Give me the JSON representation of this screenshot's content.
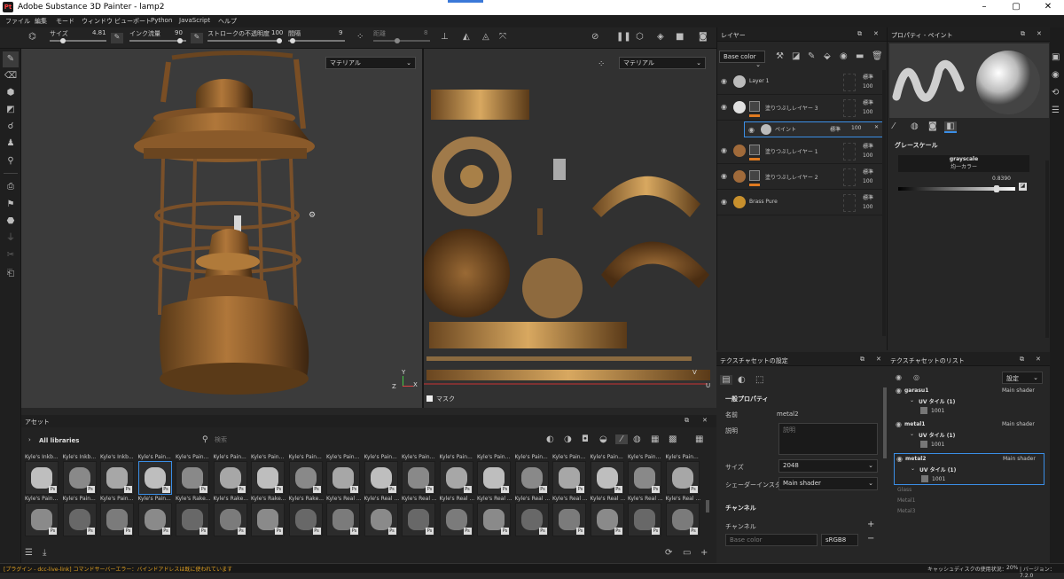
{
  "window": {
    "title": "Adobe Substance 3D Painter - lamp2",
    "app_icon": "Pt"
  },
  "menu": [
    "ファイル",
    "編集",
    "モード",
    "ウィンドウ",
    "ビューポート",
    "Python",
    "JavaScript",
    "ヘルプ"
  ],
  "toolbar": {
    "size_label": "サイズ",
    "size_value": "4.81",
    "flow_label": "インク流量",
    "flow_value": "90",
    "stroke_label": "ストロークの不透明度",
    "stroke_value": "100",
    "spacing_label": "間隔",
    "spacing_value": "9",
    "distance_label": "距離",
    "distance_value": "8"
  },
  "viewport": {
    "mode_3d": "マテリアル",
    "mode_2d": "マテリアル",
    "mask_label": "マスク",
    "axis_y": "Y",
    "axis_z": "Z",
    "axis_x": "X",
    "axis_u": "U",
    "axis_v": "V"
  },
  "assets": {
    "title": "アセット",
    "libraries": "All libraries",
    "search_placeholder": "検索",
    "row1": [
      "Kyle's Inkb...",
      "Kyle's Inkb...",
      "Kyle's Inkb...",
      "Kyle's Pain...",
      "Kyle's Pain...",
      "Kyle's Pain...",
      "Kyle's Pain...",
      "Kyle's Pain...",
      "Kyle's Pain...",
      "Kyle's Pain...",
      "Kyle's Pain...",
      "Kyle's Pain...",
      "Kyle's Pain...",
      "Kyle's Pain...",
      "Kyle's Pain...",
      "Kyle's Pain...",
      "Kyle's Pain...",
      "Kyle's Pain..."
    ],
    "row2": [
      "Kyle's Pain...",
      "Kyle's Pain...",
      "Kyle's Pain...",
      "Kyle's Pain...",
      "Kyle's Rake...",
      "Kyle's Rake...",
      "Kyle's Rake...",
      "Kyle's Rake...",
      "Kyle's Real ...",
      "Kyle's Real ...",
      "Kyle's Real ...",
      "Kyle's Real ...",
      "Kyle's Real ...",
      "Kyle's Real ...",
      "Kyle's Real ...",
      "Kyle's Real ...",
      "Kyle's Real ...",
      "Kyle's Real ..."
    ]
  },
  "status": {
    "error": "[プラグイン - dcc-live-link] コマンドサーバーエラー：バインドアドレスは既に使われています",
    "cache": "キャッシュディスクの使用状況：",
    "cache_value": "20%",
    "version": "| バージョン：7.2.0"
  },
  "layers": {
    "title": "レイヤー",
    "channel": "Base color",
    "items": [
      {
        "name": "Layer 1",
        "blend": "標準",
        "opacity": "100",
        "color": "#bbb"
      },
      {
        "name": "塗りつぶしレイヤー 3",
        "blend": "標準",
        "opacity": "100",
        "color": "#e0e0e0"
      },
      {
        "name": "ペイント",
        "blend": "標準",
        "opacity": "100",
        "color": "#bbb"
      },
      {
        "name": "塗りつぶしレイヤー 1",
        "blend": "標準",
        "opacity": "100",
        "color": "#a06a3a"
      },
      {
        "name": "塗りつぶしレイヤー 2",
        "blend": "標準",
        "opacity": "100",
        "color": "#a06a3a"
      },
      {
        "name": "Brass Pure",
        "blend": "標準",
        "opacity": "100",
        "color": "#c8902d"
      }
    ]
  },
  "properties": {
    "title": "プロパティ - ペイント",
    "grayscale_title": "グレースケール",
    "grayscale_name": "grayscale",
    "grayscale_sub": "均一カラー",
    "grayscale_value": "0.8390"
  },
  "texset_settings": {
    "title": "テクスチャセットの設定",
    "general": "一般プロパティ",
    "name_label": "名前",
    "name_value": "metal2",
    "desc_label": "説明",
    "desc_placeholder": "説明",
    "size_label": "サイズ",
    "size_value": "2048",
    "shader_label": "シェーダーインスタンス",
    "shader_value": "Main shader",
    "channels_title": "チャンネル",
    "channels_label": "チャンネル",
    "channel_name": "Base color",
    "channel_format": "sRGB8"
  },
  "texset_list": {
    "title": "テクスチャセットのリスト",
    "settings": "設定",
    "sets": [
      {
        "name": "garasu1",
        "shader": "Main shader",
        "uv": "UV タイル (1)",
        "tile": "1001",
        "active": false,
        "enabled": true
      },
      {
        "name": "metal1",
        "shader": "Main shader",
        "uv": "UV タイル (1)",
        "tile": "1001",
        "active": false,
        "enabled": true
      },
      {
        "name": "metal2",
        "shader": "Main shader",
        "uv": "UV タイル (1)",
        "tile": "1001",
        "active": true,
        "enabled": true
      }
    ],
    "disabled": [
      "Glass",
      "Metal1",
      "Metal3"
    ]
  }
}
